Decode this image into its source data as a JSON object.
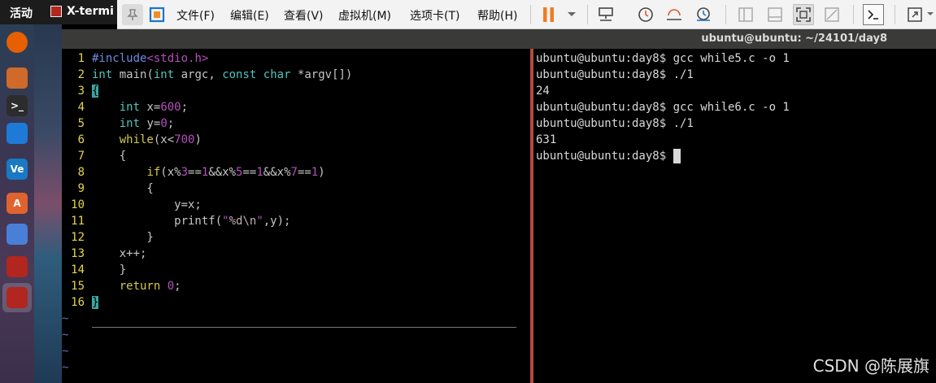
{
  "topbar": {
    "activities": "活动",
    "app_name": "X-termi"
  },
  "dock": {
    "items": [
      {
        "name": "firefox",
        "glyph": "",
        "color": "#e66000"
      },
      {
        "name": "files",
        "glyph": "",
        "color": "#cf6a2a"
      },
      {
        "name": "terminal",
        "glyph": ">_",
        "color": "#2c2c2c"
      },
      {
        "name": "vscode",
        "glyph": "",
        "color": "#1e7ad6"
      },
      {
        "name": "vmware",
        "glyph": "Ve",
        "color": "#1979c3"
      },
      {
        "name": "software",
        "glyph": "A",
        "color": "#e0632e"
      },
      {
        "name": "network",
        "glyph": "",
        "color": "#4a7fd8"
      },
      {
        "name": "app-red-1",
        "glyph": "",
        "color": "#b1261e"
      },
      {
        "name": "app-red-2",
        "glyph": "",
        "color": "#b1261e"
      }
    ]
  },
  "vm_toolbar": {
    "menus": [
      "文件(F)",
      "编辑(E)",
      "查看(V)",
      "虚拟机(M)",
      "选项卡(T)",
      "帮助(H)"
    ]
  },
  "terminal": {
    "title": "ubuntu@ubuntu: ~/24101/day8",
    "vim_lines": [
      {
        "n": "1",
        "segs": [
          [
            "t-pre",
            "#include"
          ],
          [
            "t-inc",
            "<stdio.h>"
          ]
        ]
      },
      {
        "n": "2",
        "segs": [
          [
            "t-type",
            "int"
          ],
          [
            "t-def",
            " main("
          ],
          [
            "t-type",
            "int"
          ],
          [
            "t-def",
            " argc, "
          ],
          [
            "t-type",
            "const"
          ],
          [
            "t-def",
            " "
          ],
          [
            "t-type",
            "char"
          ],
          [
            "t-def",
            " *argv[])"
          ]
        ]
      },
      {
        "n": "3",
        "segs": [
          [
            "cursor-block",
            "{"
          ]
        ]
      },
      {
        "n": "4",
        "segs": [
          [
            "t-def",
            "    "
          ],
          [
            "t-type",
            "int"
          ],
          [
            "t-def",
            " x="
          ],
          [
            "t-num",
            "600"
          ],
          [
            "t-def",
            ";"
          ]
        ]
      },
      {
        "n": "5",
        "segs": [
          [
            "t-def",
            "    "
          ],
          [
            "t-type",
            "int"
          ],
          [
            "t-def",
            " y="
          ],
          [
            "t-num",
            "0"
          ],
          [
            "t-def",
            ";"
          ]
        ]
      },
      {
        "n": "6",
        "segs": [
          [
            "t-def",
            "    "
          ],
          [
            "t-kw",
            "while"
          ],
          [
            "t-def",
            "(x<"
          ],
          [
            "t-num",
            "700"
          ],
          [
            "t-def",
            ")"
          ]
        ]
      },
      {
        "n": "7",
        "segs": [
          [
            "t-def",
            "    {"
          ]
        ]
      },
      {
        "n": "8",
        "segs": [
          [
            "t-def",
            "        "
          ],
          [
            "t-kw",
            "if"
          ],
          [
            "t-def",
            "(x%"
          ],
          [
            "t-num",
            "3"
          ],
          [
            "t-def",
            "=="
          ],
          [
            "t-num",
            "1"
          ],
          [
            "t-def",
            "&&x%"
          ],
          [
            "t-num",
            "5"
          ],
          [
            "t-def",
            "=="
          ],
          [
            "t-num",
            "1"
          ],
          [
            "t-def",
            "&&x%"
          ],
          [
            "t-num",
            "7"
          ],
          [
            "t-def",
            "=="
          ],
          [
            "t-num",
            "1"
          ],
          [
            "t-def",
            ")"
          ]
        ]
      },
      {
        "n": "9",
        "segs": [
          [
            "t-def",
            "        {"
          ]
        ]
      },
      {
        "n": "10",
        "segs": [
          [
            "t-def",
            "            y=x;"
          ]
        ]
      },
      {
        "n": "11",
        "segs": [
          [
            "t-def",
            "            printf("
          ],
          [
            "t-str",
            "\""
          ],
          [
            "t-esc",
            "%d\\n"
          ],
          [
            "t-str",
            "\""
          ],
          [
            "t-def",
            ",y);"
          ]
        ]
      },
      {
        "n": "12",
        "segs": [
          [
            "t-def",
            "        }"
          ]
        ]
      },
      {
        "n": "13",
        "segs": [
          [
            "t-def",
            "    x++;"
          ]
        ]
      },
      {
        "n": "14",
        "segs": [
          [
            "t-def",
            "    }"
          ]
        ]
      },
      {
        "n": "15",
        "segs": [
          [
            "t-def",
            "    "
          ],
          [
            "t-kw",
            "return"
          ],
          [
            "t-def",
            " "
          ],
          [
            "t-num",
            "0"
          ],
          [
            "t-def",
            ";"
          ]
        ]
      },
      {
        "n": "16",
        "segs": [
          [
            "cursor-block",
            "}"
          ]
        ]
      }
    ],
    "tildes": [
      "~",
      "~",
      "~",
      "~"
    ],
    "shell_lines": [
      "ubuntu@ubuntu:day8$ gcc while5.c -o 1",
      "ubuntu@ubuntu:day8$ ./1",
      "24",
      "ubuntu@ubuntu:day8$ gcc while6.c -o 1",
      "ubuntu@ubuntu:day8$ ./1",
      "631",
      "ubuntu@ubuntu:day8$ "
    ]
  },
  "watermark": "CSDN @陈展旗",
  "colors": {
    "divider": "#b34a43",
    "line_numbers": "#e5d54d",
    "cursor": "#3aa6a2"
  }
}
